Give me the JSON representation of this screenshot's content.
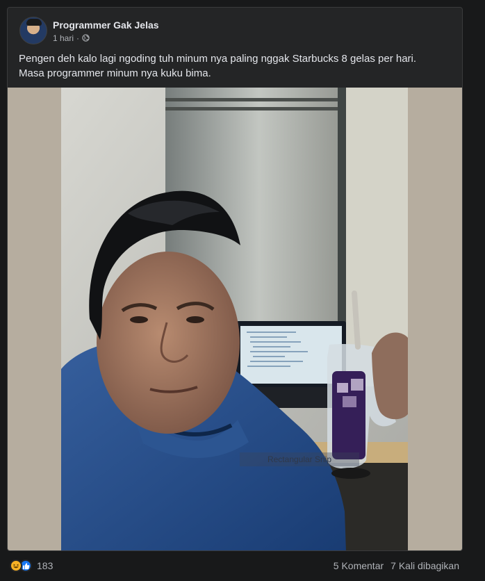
{
  "post": {
    "author": "Programmer Gak Jelas",
    "time": "1 hari",
    "separator": "·",
    "privacy_icon": "globe-icon",
    "text_line1": "Pengen deh kalo lagi ngoding tuh minum nya paling nggak Starbucks 8 gelas per hari.",
    "text_line2": "Masa programmer minum nya kuku bima."
  },
  "photo": {
    "snip_label": "Rectangular Snip"
  },
  "footer": {
    "reaction_icons": [
      "haha-icon",
      "like-icon"
    ],
    "reaction_count": "183",
    "comments": "5 Komentar",
    "shares": "7 Kali dibagikan"
  },
  "colors": {
    "background": "#18191a",
    "card": "#242526",
    "text": "#e4e6eb",
    "secondary_text": "#b0b3b8",
    "like_blue": "#1877f2",
    "haha_yellow": "#f7b125"
  }
}
